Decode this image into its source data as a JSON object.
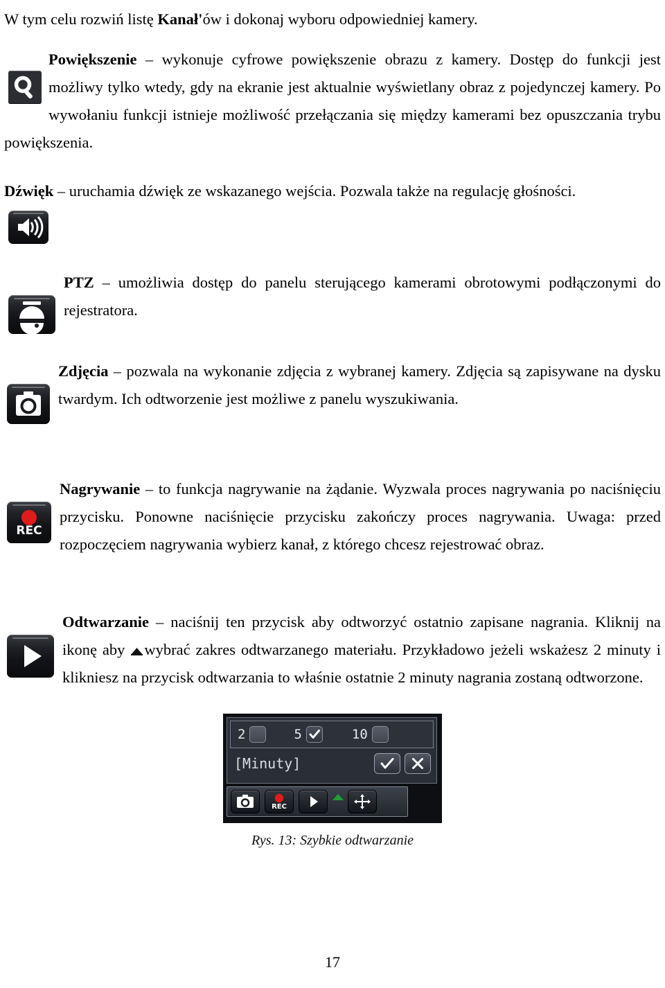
{
  "page": {
    "number": "17",
    "language": "pl"
  },
  "intro": {
    "text_before_bold": "W tym celu rozwiń listę ",
    "bold": "Kanał'",
    "text_after_bold": "ów i dokonaj wyboru odpowiedniej kamery."
  },
  "sections": [
    {
      "id": "zoom",
      "icon": "magnifier-icon",
      "term": "Powiększenie",
      "dash": " – ",
      "body": "wykonuje cyfrowe powiększenie obrazu z kamery. Dostęp do funkcji jest możliwy tylko wtedy, gdy na ekranie jest aktualnie wyświetlany obraz z pojedynczej kamery. Po wywołaniu funkcji istnieje możliwość przełączania się między kamerami bez opuszczania trybu powiększenia."
    },
    {
      "id": "audio",
      "icon": "speaker-icon",
      "term": "Dźwięk",
      "dash": " – ",
      "body": "uruchamia dźwięk ze wskazanego wejścia. Pozwala także na regulację głośności."
    },
    {
      "id": "ptz",
      "icon": "dome-camera-icon",
      "term": "PTZ",
      "dash": " – ",
      "body": "umożliwia dostęp do panelu sterującego kamerami obrotowymi podłączonymi do rejestratora."
    },
    {
      "id": "snapshot",
      "icon": "camera-icon",
      "term": "Zdjęcia",
      "dash": " – ",
      "body": "pozwala na wykonanie zdjęcia z wybranej kamery. Zdjęcia są zapisywane na dysku twardym. Ich odtworzenie jest możliwe z panelu wyszukiwania."
    },
    {
      "id": "record",
      "icon": "rec-icon",
      "term": "Nagrywanie",
      "dash": " – ",
      "body": "to funkcja nagrywanie na żądanie. Wyzwala proces nagrywania po naciśnięciu przycisku. Ponowne naciśnięcie przycisku zakończy proces nagrywania. Uwaga: przed rozpoczęciem nagrywania wybierz kanał, z którego chcesz rejestrować obraz."
    },
    {
      "id": "playback",
      "icon": "play-icon",
      "term": "Odtwarzanie",
      "dash": " – ",
      "body_1": "naciśnij ten przycisk aby odtworzyć ostatnio zapisane nagrania. Kliknij na ikonę aby ",
      "inline_icon": "triangle-up-icon",
      "body_2": "wybrać zakres odtwarzanego materiału. Przykładowo jeżeli wskażesz 2 minuty i klikniesz na przycisk odtwarzania to właśnie ostatnie 2 minuty nagrania zostaną odtworzone."
    }
  ],
  "figure": {
    "caption": "Rys. 13: Szybkie odtwarzanie",
    "dialog": {
      "options": [
        {
          "label": "2",
          "checked": false
        },
        {
          "label": "5",
          "checked": true
        },
        {
          "label": "10",
          "checked": false
        }
      ],
      "unit_label": "[Minuty]",
      "confirm_icon": "check-icon",
      "cancel_icon": "close-icon"
    },
    "toolbar": {
      "buttons": [
        {
          "icon": "camera-icon",
          "label": ""
        },
        {
          "icon": "rec-icon",
          "label": "REC"
        },
        {
          "icon": "play-icon",
          "label": ""
        },
        {
          "icon": "pan-tilt-icon",
          "label": ""
        }
      ],
      "expand_arrow_icon": "triangle-up-green-icon"
    },
    "colors": {
      "panel_bg": "#0d0f13",
      "dialog_bg": "#2a2e36",
      "dialog_border": "#6d7481",
      "text": "#e8eaee",
      "rec_red": "#e01b1b",
      "arrow_green": "#1f9e33"
    }
  }
}
